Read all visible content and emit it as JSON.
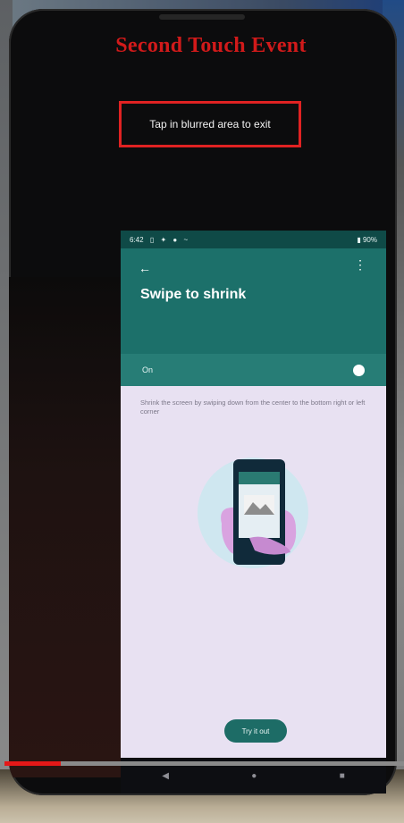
{
  "overlay": {
    "heading": "Second Touch Event",
    "exit_hint": "Tap in blurred area to exit"
  },
  "status_bar": {
    "time": "6:42",
    "battery": "90%"
  },
  "screen": {
    "title": "Swipe to shrink",
    "toggle_label": "On",
    "toggle_on": true,
    "description": "Shrink the screen by swiping down from the center to the bottom right or left corner",
    "button_label": "Try it out"
  },
  "video_progress": 0.14,
  "colors": {
    "accent_dark": "#0f4a47",
    "accent": "#1c706a",
    "annotation_red": "#e02222"
  }
}
